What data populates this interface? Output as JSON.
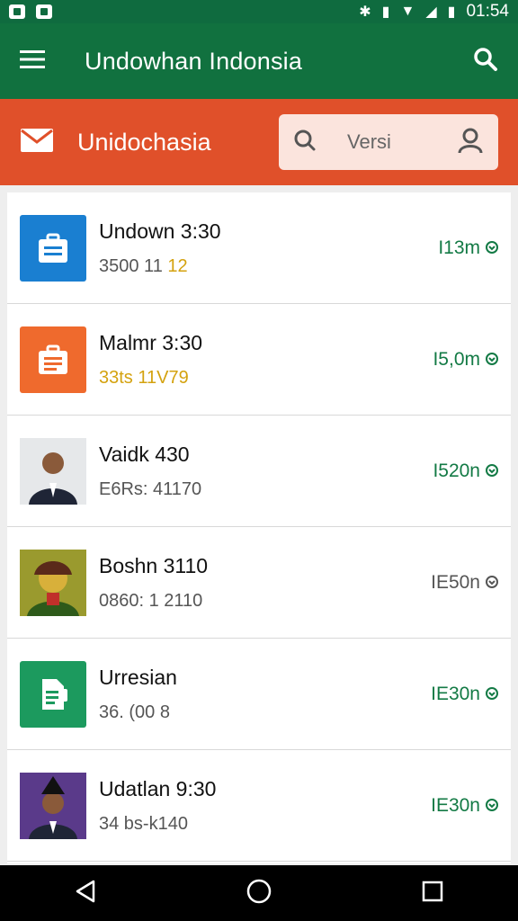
{
  "status_bar": {
    "time": "01:54"
  },
  "app_bar": {
    "title": "Undowhan Indonsia"
  },
  "sub_bar": {
    "title": "Unidochasia",
    "search_text": "Versi"
  },
  "items": [
    {
      "title": "Undown 3:30",
      "sub_a": "3500 11 ",
      "sub_b": "12",
      "right": "I13m",
      "thumb": "briefcase"
    },
    {
      "title": "Malmr 3:30",
      "sub_a": "",
      "sub_b": "33ts 11V79",
      "right": "I5,0m",
      "thumb": "briefcase"
    },
    {
      "title": "Vaidk 430",
      "sub_a": "E6Rs: 41170",
      "sub_b": "",
      "right": "I520n",
      "thumb": "photo-person"
    },
    {
      "title": "Boshn 3110",
      "sub_a": "0860: 1 2110",
      "sub_b": "",
      "right": "IE50n",
      "thumb": "photo-person"
    },
    {
      "title": "Urresian",
      "sub_a": "36. (00 8",
      "sub_b": "",
      "right": "IE30n",
      "thumb": "document"
    },
    {
      "title": "Udatlan 9:30",
      "sub_a": "34 bs-k140",
      "sub_b": "",
      "right": "IE30n",
      "thumb": "photo-person"
    }
  ],
  "colors": {
    "green": "#11713f",
    "orange": "#e0502a",
    "accent_text": "#137a45",
    "gold": "#d4a20f"
  }
}
